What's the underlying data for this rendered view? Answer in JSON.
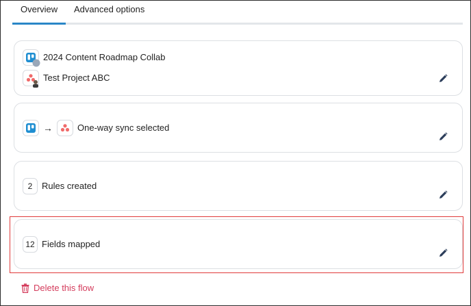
{
  "tabs": [
    {
      "label": "Overview",
      "active": true
    },
    {
      "label": "Advanced options",
      "active": false
    }
  ],
  "cards": {
    "projects": {
      "source_name": "2024 Content Roadmap Collab",
      "target_name": "Test Project ABC",
      "source_icon": "trello-icon",
      "target_icon": "asana-icon"
    },
    "sync": {
      "arrow": "→",
      "label": "One-way sync selected"
    },
    "rules": {
      "count": "2",
      "label": "Rules created"
    },
    "fields": {
      "count": "12",
      "label": "Fields mapped"
    }
  },
  "delete_label": "Delete this flow",
  "colors": {
    "accent": "#2a86c7",
    "trello": "#1f8ed1",
    "asana": "#f06a6a",
    "danger": "#d43c5c",
    "highlight": "#e03a3a",
    "edit_icon": "#2b3d5a"
  }
}
